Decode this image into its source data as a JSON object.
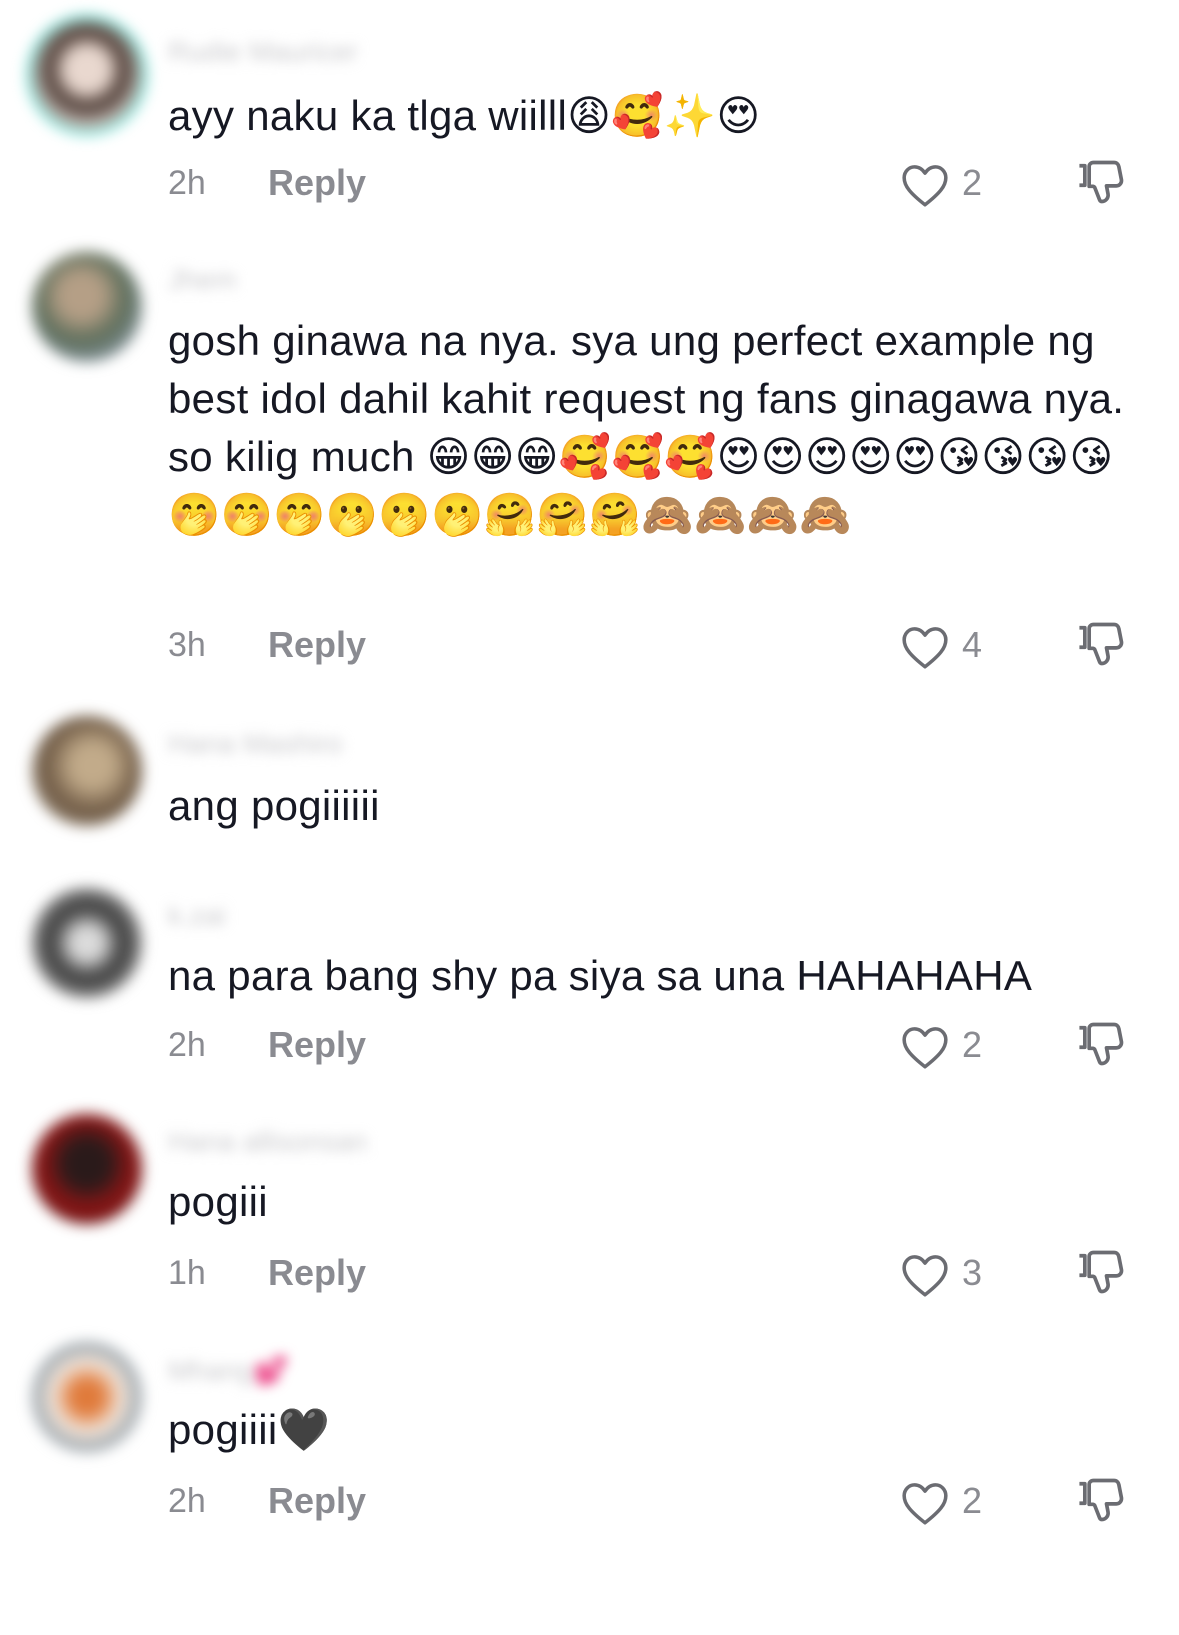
{
  "comments": [
    {
      "username": "Rudie Mauricer",
      "text": "ayy naku ka tlga wiilll😩🥰✨😍",
      "time": "2h",
      "reply_label": "Reply",
      "likes": "2",
      "avatar_color": "#c9b6a9",
      "avatar_ring": "#5fe3d8"
    },
    {
      "username": "Jhem",
      "text": "gosh ginawa na nya. sya ung perfect example ng best idol dahil kahit request ng fans ginagawa nya. so kilig much 😁😁😁🥰🥰🥰😍😍😍😍😍😘😘😘😘🤭🤭🤭🫢🫢🫢🤗🤗🤗🙈🙈🙈🙈",
      "time": "3h",
      "reply_label": "Reply",
      "likes": "4",
      "avatar_color": "#7f8a7c"
    },
    {
      "username": "Hana Mashiro",
      "text": "ang pogiiiiii",
      "avatar_color": "#8b7a62"
    },
    {
      "username": "k.zai",
      "text": "na para bang shy pa siya sa una HAHAHAHA",
      "time": "2h",
      "reply_label": "Reply",
      "likes": "2",
      "avatar_color": "#555555"
    },
    {
      "username": "Hana allisonsan",
      "text": "pogiii",
      "time": "1h",
      "reply_label": "Reply",
      "likes": "3",
      "avatar_color": "#7a1414"
    },
    {
      "username": "Mhang💕",
      "text": "pogiiii🖤",
      "time": "2h",
      "reply_label": "Reply",
      "likes": "2",
      "avatar_color": "#a97a5a"
    }
  ],
  "icons": {
    "like": "heart-outline-icon",
    "dislike": "thumbs-down-icon"
  },
  "colors": {
    "text": "#161823",
    "meta": "#8a8b91",
    "background": "#ffffff"
  }
}
